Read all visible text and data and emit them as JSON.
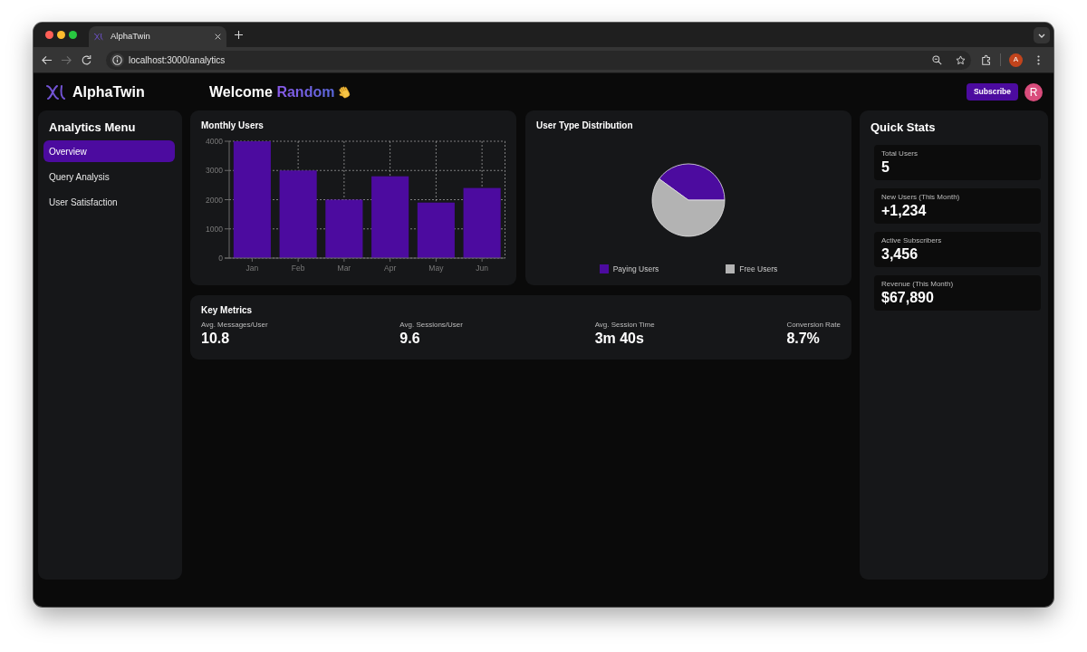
{
  "browser": {
    "tabs": [
      {
        "title": "AlphaTwin",
        "selected": true
      }
    ],
    "nav_buttons": [
      {
        "kind": "back",
        "disabled": false
      },
      {
        "kind": "forward",
        "disabled": true
      },
      {
        "kind": "reload",
        "disabled": false
      }
    ],
    "address": "localhost:3000/analytics",
    "profile_initial": "A"
  },
  "header": {
    "brand": "AlphaTwin",
    "greeting": "Welcome",
    "user_name": "Random",
    "subscribe_button": "Subscribe",
    "avatar_initial": "R"
  },
  "sidebar": {
    "title": "Analytics Menu",
    "items": [
      {
        "label": "Overview",
        "selected": true
      },
      {
        "label": "Query Analysis",
        "selected": false
      },
      {
        "label": "User Satisfaction",
        "selected": false
      }
    ]
  },
  "monthly_users": {
    "chart_data": {
      "type": "bar",
      "title": "Monthly Users",
      "categories": [
        "Jan",
        "Feb",
        "Mar",
        "Apr",
        "May",
        "Jun"
      ],
      "series": [
        {
          "color": "#4c0b9f",
          "values": [
            4000,
            3000,
            2000,
            2800,
            1900,
            2400
          ]
        }
      ],
      "ylim": [
        0,
        4000
      ],
      "yticks": [
        0,
        1000,
        2000,
        3000,
        4000
      ],
      "grid": true
    }
  },
  "user_types": {
    "title": "User Type Distribution",
    "legend": [
      {
        "label": "Paying Users",
        "color": "#4c0b9f"
      },
      {
        "label": "Free Users",
        "color": "#b3b3b3"
      }
    ]
  },
  "key_metrics": {
    "title": "Key Metrics",
    "items": [
      {
        "label": "Avg. Messages/User",
        "value": "10.8"
      },
      {
        "label": "Avg. Sessions/User",
        "value": "9.6"
      },
      {
        "label": "Avg. Session Time",
        "value": "3m 40s"
      },
      {
        "label": "Conversion Rate",
        "value": "8.7%"
      }
    ]
  },
  "quick_stats": {
    "title": "Quick Stats",
    "items": [
      {
        "label": "Total Users",
        "value": "5"
      },
      {
        "label": "New Users (This Month)",
        "value": "+1,234"
      },
      {
        "label": "Active Subscribers",
        "value": "3,456"
      },
      {
        "label": "Revenue (This Month)",
        "value": "$67,890"
      }
    ]
  }
}
